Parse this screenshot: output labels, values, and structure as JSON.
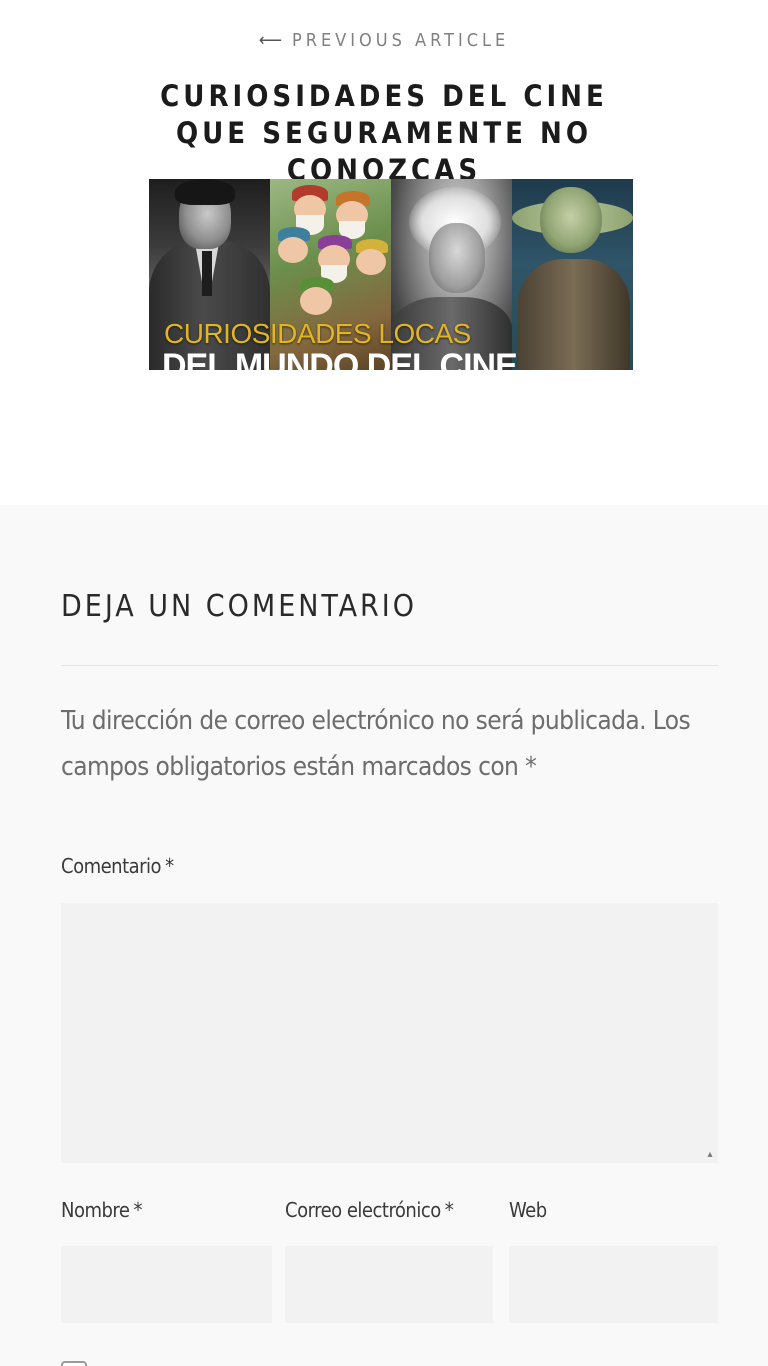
{
  "previous_article": {
    "nav_label": "PREVIOUS ARTICLE",
    "arrow_icon": "arrow-left-icon",
    "title": "CURIOSIDADES DEL CINE QUE SEGURAMENTE NO CONOZCAS",
    "thumbnail": {
      "line1": "CURIOSIDADES LOCAS",
      "line2": "DEL MUNDO DEL CINE"
    }
  },
  "comments": {
    "heading": "DEJA UN COMENTARIO",
    "notes": "Tu dirección de correo electrónico no será publicada. Los campos obligatorios están marcados con *",
    "required_mark": "*",
    "fields": {
      "comment": {
        "label": "Comentario",
        "value": ""
      },
      "name": {
        "label": "Nombre",
        "value": ""
      },
      "email": {
        "label": "Correo electrónico",
        "value": ""
      },
      "website": {
        "label": "Web",
        "value": ""
      }
    },
    "resize_icon": "resize-handle-icon"
  },
  "colors": {
    "page_background": "#ffffff",
    "comments_background": "#f9f9f9",
    "input_background": "#f2f2f2",
    "thumbnail_yellow_text": "#e2b523"
  }
}
